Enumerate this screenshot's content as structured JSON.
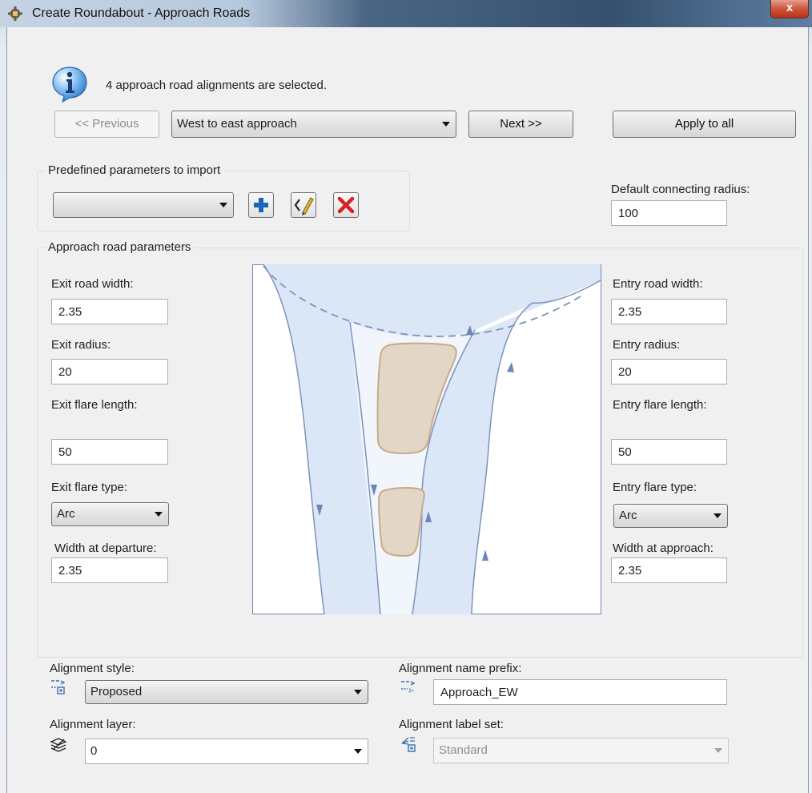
{
  "window": {
    "title": "Create Roundabout - Approach Roads",
    "close_label": "x"
  },
  "info": {
    "message": "4  approach road alignments are selected."
  },
  "nav": {
    "previous_label": "<< Previous",
    "approach_selected": "West to east approach",
    "next_label": "Next >>",
    "apply_all_label": "Apply to all"
  },
  "predefined": {
    "group_title": "Predefined parameters to import",
    "selected": ""
  },
  "default_radius": {
    "label": "Default connecting radius:",
    "value": "100"
  },
  "approach_params": {
    "group_title": "Approach road parameters",
    "exit_road_width_label": "Exit road width:",
    "exit_road_width": "2.35",
    "exit_radius_label": "Exit radius:",
    "exit_radius": "20",
    "exit_flare_length_label": "Exit flare length:",
    "exit_flare_length": "50",
    "exit_flare_type_label": "Exit flare type:",
    "exit_flare_type": "Arc",
    "width_departure_label": "Width at departure:",
    "width_departure": "2.35",
    "entry_road_width_label": "Entry road width:",
    "entry_road_width": "2.35",
    "entry_radius_label": "Entry radius:",
    "entry_radius": "20",
    "entry_flare_length_label": "Entry flare length:",
    "entry_flare_length": "50",
    "entry_flare_type_label": "Entry flare type:",
    "entry_flare_type": "Arc",
    "width_approach_label": "Width at approach:",
    "width_approach": "2.35"
  },
  "alignment": {
    "style_label": "Alignment style:",
    "style_value": "Proposed",
    "layer_label": "Alignment layer:",
    "layer_value": "0",
    "name_prefix_label": "Alignment name prefix:",
    "name_prefix_value": "Approach_EW",
    "label_set_label": "Alignment label set:",
    "label_set_value": "Standard"
  },
  "colors": {
    "road": "#dbe6f7",
    "road_edge": "#7d93bd",
    "island": "#e2d6c6",
    "island_edge": "#c9aa86"
  },
  "icons": [
    "roundabout-icon",
    "info-icon",
    "add-icon",
    "edit-icon",
    "delete-icon",
    "alignment-style-icon",
    "alignment-name-icon",
    "layer-icon",
    "label-set-icon"
  ]
}
